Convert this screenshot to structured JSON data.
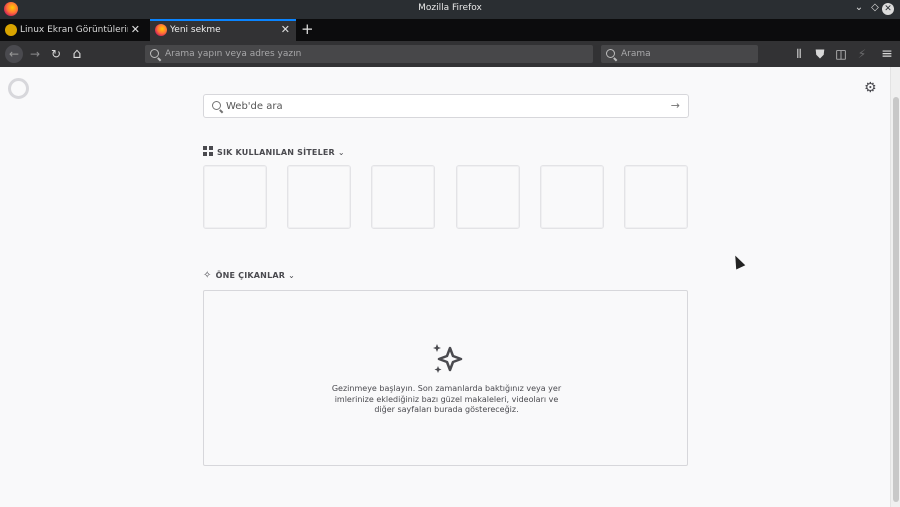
{
  "window": {
    "title": "Mozilla Firefox",
    "controls": {
      "minimize": "⌄",
      "maximize": "◇",
      "close": "✕"
    }
  },
  "tabs": [
    {
      "label": "Linux Ekran Görüntülerin",
      "close": "✕",
      "active": false
    },
    {
      "label": "Yeni sekme",
      "close": "✕",
      "active": true
    }
  ],
  "new_tab": "+",
  "toolbar": {
    "back": "←",
    "forward": "→",
    "reload": "↻",
    "home": "⌂",
    "url_placeholder": "Arama yapın veya adres yazın",
    "search_placeholder": "Arama",
    "library": "⫴",
    "shield": "⛊",
    "sidebar": "◫",
    "extension": "⚡",
    "menu": "≡"
  },
  "newtab_page": {
    "websearch_placeholder": "Web'de ara",
    "websearch_go": "→",
    "gear": "⚙",
    "top_sites": {
      "title": "SIK KULLANILAN SİTELER",
      "chevron": "⌄",
      "tile_count": 6
    },
    "highlights": {
      "title": "ÖNE ÇIKANLAR",
      "chevron": "⌄",
      "empty_message": "Gezinmeye başlayın. Son zamanlarda baktığınız veya yer imlerinize eklediğiniz bazı güzel makaleleri, videoları ve diğer sayfaları burada göstereceğiz."
    }
  },
  "colors": {
    "accent": "#0a84ff",
    "toolbar_bg": "#323234",
    "page_bg": "#f9f9fa"
  }
}
